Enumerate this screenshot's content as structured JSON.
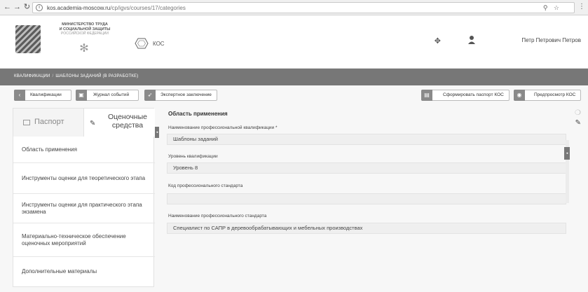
{
  "browser": {
    "url_host": "kos.academia-moscow.ru",
    "url_path": "/cp/igvs/courses/17/categories"
  },
  "header": {
    "logo_line1": "МИНИСТЕРСТВО ТРУДА",
    "logo_line2": "И СОЦИАЛЬНОЙ ЗАЩИТЫ",
    "logo_line3": "РОССИЙСКОЙ ФЕДЕРАЦИИ",
    "kos_label": "КОС",
    "user_name": "Петр Петрович Петров"
  },
  "breadcrumb": {
    "items": [
      "КВАЛИФИКАЦИИ",
      "ШАБЛОНЫ ЗАДАНИЙ (В РАЗРАБОТКЕ)"
    ],
    "separator": "/"
  },
  "toolbar": {
    "qualifications": "Квалификации",
    "events_log": "Журнал событий",
    "expert_conclusion": "Экспертное заключение",
    "generate_passport": "Сформировать паспорт КОС",
    "preview": "Предпросмотр КОС"
  },
  "tabs": {
    "passport": "Паспорт",
    "tools": "Оценочные средства"
  },
  "menu": [
    "Область применения",
    "Инструменты оценки для теоретического этапа",
    "Инструменты оценки для практического этапа экзамена",
    "Материально-техническое обеспечение оценочных мероприятий",
    "Дополнительные материалы"
  ],
  "form": {
    "section_title": "Область применения",
    "qual_name_label": "Наименование профессиональной квалификации *",
    "qual_name_value": "Шаблоны заданий",
    "qual_level_label": "Уровень квалификации",
    "qual_level_value": "Уровень 8",
    "standard_code_label": "Код профессионального стандарта",
    "standard_code_value": "",
    "standard_name_label": "Наименование профессионального стандарта",
    "standard_name_value": "Специалист по САПР в деревообрабатывающих и мебельных производствах"
  },
  "colors": {
    "band": "#777777",
    "button_icon": "#8a8a8a",
    "field_bg": "#efefef"
  }
}
